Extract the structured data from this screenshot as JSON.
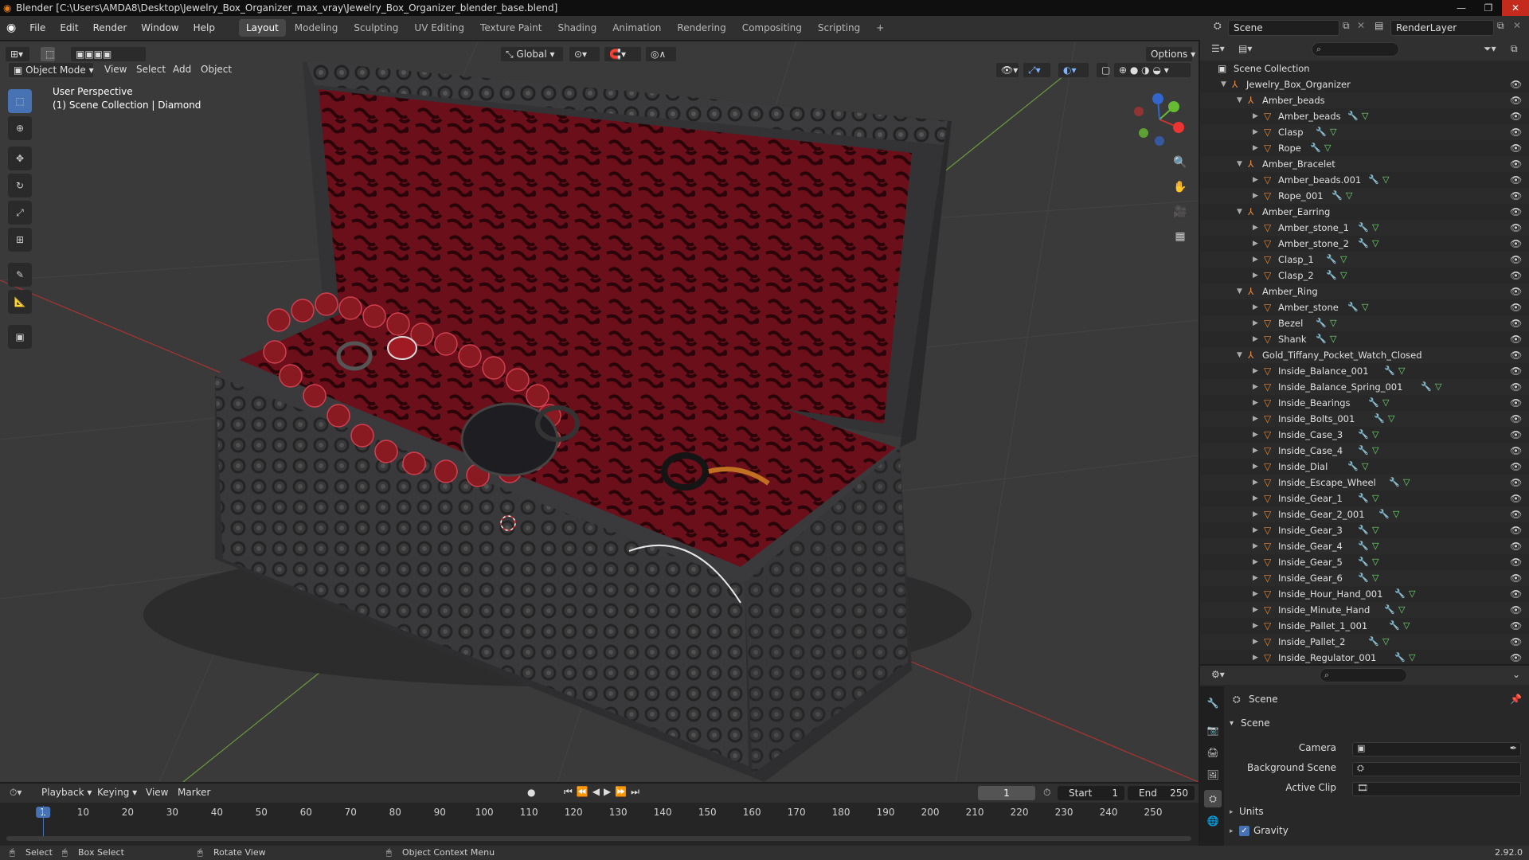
{
  "window": {
    "title": "Blender [C:\\Users\\AMDA8\\Desktop\\Jewelry_Box_Organizer_max_vray\\Jewelry_Box_Organizer_blender_base.blend]"
  },
  "menus": [
    "File",
    "Edit",
    "Render",
    "Window",
    "Help"
  ],
  "workspaces": [
    "Layout",
    "Modeling",
    "Sculpting",
    "UV Editing",
    "Texture Paint",
    "Shading",
    "Animation",
    "Rendering",
    "Compositing",
    "Scripting"
  ],
  "scene_selector": "Scene",
  "renderlayer_selector": "RenderLayer",
  "viewport": {
    "mode": "Object Mode",
    "menus": [
      "View",
      "Select",
      "Add",
      "Object"
    ],
    "transform_orientation": "Global",
    "options_label": "Options",
    "info_line1": "User Perspective",
    "info_line2": "(1) Scene Collection | Diamond"
  },
  "outliner": {
    "root": "Scene Collection",
    "rows": [
      {
        "label": "Jewelry_Box_Organizer",
        "level": 0,
        "type": "empty",
        "expanded": true
      },
      {
        "label": "Amber_beads",
        "level": 1,
        "type": "empty",
        "expanded": true
      },
      {
        "label": "Amber_beads",
        "level": 2,
        "type": "mesh",
        "mods": 2
      },
      {
        "label": "Clasp",
        "level": 2,
        "type": "mesh",
        "mods": 2
      },
      {
        "label": "Rope",
        "level": 2,
        "type": "mesh",
        "mods": 2
      },
      {
        "label": "Amber_Bracelet",
        "level": 1,
        "type": "empty",
        "expanded": true
      },
      {
        "label": "Amber_beads.001",
        "level": 2,
        "type": "mesh",
        "mods": 2
      },
      {
        "label": "Rope_001",
        "level": 2,
        "type": "mesh",
        "mods": 2
      },
      {
        "label": "Amber_Earring",
        "level": 1,
        "type": "empty",
        "expanded": true
      },
      {
        "label": "Amber_stone_1",
        "level": 2,
        "type": "mesh",
        "mods": 2
      },
      {
        "label": "Amber_stone_2",
        "level": 2,
        "type": "mesh",
        "mods": 2
      },
      {
        "label": "Clasp_1",
        "level": 2,
        "type": "mesh",
        "mods": 2
      },
      {
        "label": "Clasp_2",
        "level": 2,
        "type": "mesh",
        "mods": 2
      },
      {
        "label": "Amber_Ring",
        "level": 1,
        "type": "empty",
        "expanded": true
      },
      {
        "label": "Amber_stone",
        "level": 2,
        "type": "mesh",
        "mods": 2
      },
      {
        "label": "Bezel",
        "level": 2,
        "type": "mesh",
        "mods": 2
      },
      {
        "label": "Shank",
        "level": 2,
        "type": "mesh",
        "mods": 2
      },
      {
        "label": "Gold_Tiffany_Pocket_Watch_Closed",
        "level": 1,
        "type": "empty",
        "expanded": true
      },
      {
        "label": "Inside_Balance_001",
        "level": 2,
        "type": "mesh",
        "mods": 2
      },
      {
        "label": "Inside_Balance_Spring_001",
        "level": 2,
        "type": "mesh",
        "mods": 2
      },
      {
        "label": "Inside_Bearings",
        "level": 2,
        "type": "mesh",
        "mods": 2
      },
      {
        "label": "Inside_Bolts_001",
        "level": 2,
        "type": "mesh",
        "mods": 2
      },
      {
        "label": "Inside_Case_3",
        "level": 2,
        "type": "mesh",
        "mods": 2
      },
      {
        "label": "Inside_Case_4",
        "level": 2,
        "type": "mesh",
        "mods": 2
      },
      {
        "label": "Inside_Dial",
        "level": 2,
        "type": "mesh",
        "mods": 2
      },
      {
        "label": "Inside_Escape_Wheel",
        "level": 2,
        "type": "mesh",
        "mods": 2
      },
      {
        "label": "Inside_Gear_1",
        "level": 2,
        "type": "mesh",
        "mods": 2
      },
      {
        "label": "Inside_Gear_2_001",
        "level": 2,
        "type": "mesh",
        "mods": 2
      },
      {
        "label": "Inside_Gear_3",
        "level": 2,
        "type": "mesh",
        "mods": 2
      },
      {
        "label": "Inside_Gear_4",
        "level": 2,
        "type": "mesh",
        "mods": 2
      },
      {
        "label": "Inside_Gear_5",
        "level": 2,
        "type": "mesh",
        "mods": 2
      },
      {
        "label": "Inside_Gear_6",
        "level": 2,
        "type": "mesh",
        "mods": 2
      },
      {
        "label": "Inside_Hour_Hand_001",
        "level": 2,
        "type": "mesh",
        "mods": 2
      },
      {
        "label": "Inside_Minute_Hand",
        "level": 2,
        "type": "mesh",
        "mods": 2
      },
      {
        "label": "Inside_Pallet_1_001",
        "level": 2,
        "type": "mesh",
        "mods": 2
      },
      {
        "label": "Inside_Pallet_2",
        "level": 2,
        "type": "mesh",
        "mods": 2
      },
      {
        "label": "Inside_Regulator_001",
        "level": 2,
        "type": "mesh",
        "mods": 2
      }
    ]
  },
  "properties": {
    "context": "Scene",
    "panel": "Scene",
    "fields": [
      {
        "label": "Camera"
      },
      {
        "label": "Background Scene"
      },
      {
        "label": "Active Clip"
      }
    ],
    "subpanels": [
      {
        "label": "Units",
        "checkbox": false
      },
      {
        "label": "Gravity",
        "checkbox": true
      }
    ]
  },
  "timeline": {
    "menus": [
      "Playback",
      "Keying",
      "View",
      "Marker"
    ],
    "current_frame": "1",
    "start_label": "Start",
    "start": "1",
    "end_label": "End",
    "end": "250",
    "ticks": [
      "1",
      "10",
      "20",
      "30",
      "40",
      "50",
      "60",
      "70",
      "80",
      "90",
      "100",
      "110",
      "120",
      "130",
      "140",
      "150",
      "160",
      "170",
      "180",
      "190",
      "200",
      "210",
      "220",
      "230",
      "240",
      "250"
    ]
  },
  "statusbar": {
    "select": "Select",
    "box_select": "Box Select",
    "rotate_view": "Rotate View",
    "context_menu": "Object Context Menu",
    "version": "2.92.0"
  },
  "colors": {
    "accent": "#4772b3",
    "mesh_icon": "#e8893d",
    "modifier_icon": "#7fb3ff",
    "data_icon": "#70e070",
    "velvet": "#6b0f1a",
    "box_metal": "#3a3a3c"
  }
}
